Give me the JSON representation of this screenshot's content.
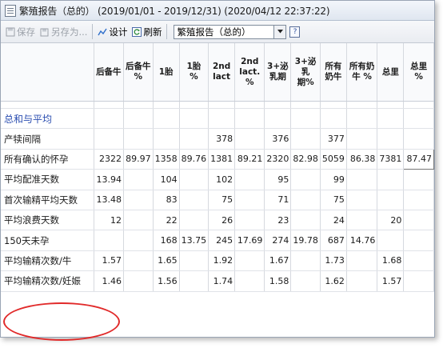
{
  "window": {
    "title": "繁殖报告（总的） (2019/01/01 - 2019/12/31) (2020/04/12 22:37:22)",
    "app_icon": "report-document-icon"
  },
  "toolbar": {
    "save_label": "保存",
    "save_as_label": "另存为...",
    "design_label": "设计",
    "refresh_label": "刷新",
    "report_select_value": "繁殖报告（总的）",
    "help_label": "?"
  },
  "table": {
    "columns": [
      "后备牛",
      "后备牛 %",
      "1胎",
      "1胎 %",
      "2nd lact",
      "2nd lact. %",
      "3+泌乳期",
      "3+泌乳期%",
      "所有奶牛",
      "所有奶牛 %",
      "总里",
      "总里 %"
    ],
    "section_label": "总和与平均",
    "rows": [
      {
        "label": "产犊间隔",
        "values": [
          "",
          "",
          "",
          "",
          "378",
          "",
          "376",
          "",
          "377",
          "",
          "",
          ""
        ]
      },
      {
        "label": "所有确认的怀孕",
        "values": [
          "2322",
          "89.97",
          "1358",
          "89.76",
          "1381",
          "89.21",
          "2320",
          "82.98",
          "5059",
          "86.38",
          "7381",
          "87.47"
        ]
      },
      {
        "label": "平均配准天数",
        "values": [
          "13.94",
          "",
          "104",
          "",
          "102",
          "",
          "95",
          "",
          "99",
          "",
          "",
          ""
        ]
      },
      {
        "label": "首次输精平均天数",
        "values": [
          "13.48",
          "",
          "83",
          "",
          "75",
          "",
          "71",
          "",
          "75",
          "",
          "",
          ""
        ]
      },
      {
        "label": "平均浪费天数",
        "values": [
          "12",
          "",
          "22",
          "",
          "26",
          "",
          "23",
          "",
          "24",
          "",
          "20",
          ""
        ]
      },
      {
        "label": "150天未孕",
        "values": [
          "",
          "",
          "168",
          "13.75",
          "245",
          "17.69",
          "274",
          "19.78",
          "687",
          "14.76",
          "",
          ""
        ]
      },
      {
        "label": "平均输精次数/牛",
        "values": [
          "1.57",
          "",
          "1.65",
          "",
          "1.92",
          "",
          "1.67",
          "",
          "1.73",
          "",
          "1.68",
          ""
        ]
      },
      {
        "label": "平均输精次数/妊娠",
        "values": [
          "1.46",
          "",
          "1.56",
          "",
          "1.74",
          "",
          "1.58",
          "",
          "1.62",
          "",
          "1.57",
          ""
        ]
      }
    ]
  },
  "colors": {
    "section_text": "#2a4db0",
    "highlight_circle": "#e12a2a"
  }
}
